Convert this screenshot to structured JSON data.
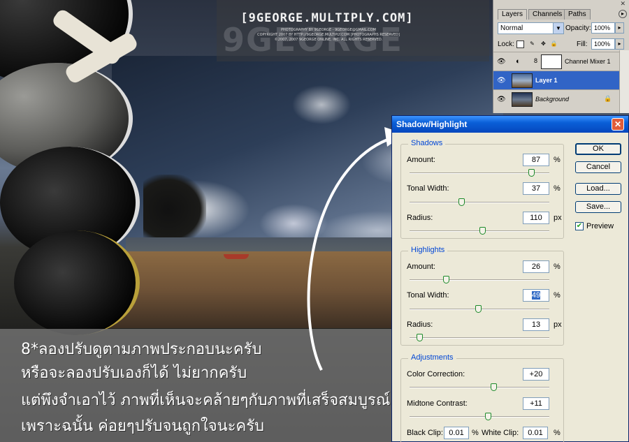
{
  "watermark": {
    "title": "[9GEORGE.MULTIPLY.COM]",
    "line1": "PHOTOGRAPHY BY 9GEORGE - 9GEORGE@GMAIL.COM",
    "line2": "COPYRIGHT 2007 BY HTTP://9GEORGE.MULTIPLY.COM [PHOTOGRAPHS RESERVED]",
    "line3": "©2007, 2007 9GEORGE ONLINE, INC. ALL RIGHTS RESERVED.",
    "big": "9GEORGE"
  },
  "caption": {
    "line1": "8*ลองปรับดูตามภาพประกอบนะครับ",
    "line2": "หรือจะลองปรับเองก็ได้ ไม่ยากครับ",
    "line3": "แต่พึงจำเอาไว้ ภาพที่เห็นจะคล้ายๆกับภาพที่เสร็จสมบูรณ์แล้ว",
    "line4": "เพราะฉนั้น ค่อยๆปรับจนถูกใจนะครับ"
  },
  "layers_panel": {
    "tabs": [
      "Layers",
      "Channels",
      "Paths"
    ],
    "blend_mode": "Normal",
    "opacity_label": "Opacity:",
    "opacity": "100%",
    "lock_label": "Lock:",
    "fill_label": "Fill:",
    "fill": "100%",
    "layers": [
      {
        "name": "Channel Mixer 1",
        "selected": false
      },
      {
        "name": "Layer 1",
        "selected": true
      },
      {
        "name": "Background",
        "selected": false
      }
    ],
    "menu_icon": "flyout-arrow-icon",
    "close_icon": "close-icon"
  },
  "dialog": {
    "title": "Shadow/Highlight",
    "buttons": {
      "ok": "OK",
      "cancel": "Cancel",
      "load": "Load...",
      "save": "Save..."
    },
    "preview_label": "Preview",
    "preview_checked": true,
    "shadows": {
      "title": "Shadows",
      "amount_label": "Amount:",
      "amount": "87",
      "amount_unit": "%",
      "tonal_label": "Tonal Width:",
      "tonal": "37",
      "tonal_unit": "%",
      "radius_label": "Radius:",
      "radius": "110",
      "radius_unit": "px"
    },
    "highlights": {
      "title": "Highlights",
      "amount_label": "Amount:",
      "amount": "26",
      "amount_unit": "%",
      "tonal_label": "Tonal Width:",
      "tonal": "49",
      "tonal_unit": "%",
      "radius_label": "Radius:",
      "radius": "13",
      "radius_unit": "px"
    },
    "adjustments": {
      "title": "Adjustments",
      "color_label": "Color Correction:",
      "color": "+20",
      "midtone_label": "Midtone Contrast:",
      "midtone": "+11",
      "black_clip_label": "Black Clip:",
      "black_clip": "0.01",
      "black_clip_unit": "%",
      "white_clip_label": "White Clip:",
      "white_clip": "0.01",
      "white_clip_unit": "%"
    },
    "slider_levels": {
      "shadows_amount": 0.87,
      "shadows_tonal": 0.37,
      "shadows_radius": 0.52,
      "highlights_amount": 0.26,
      "highlights_tonal": 0.49,
      "highlights_radius": 0.07,
      "color_correction": 0.6,
      "midtone_contrast": 0.56
    }
  }
}
